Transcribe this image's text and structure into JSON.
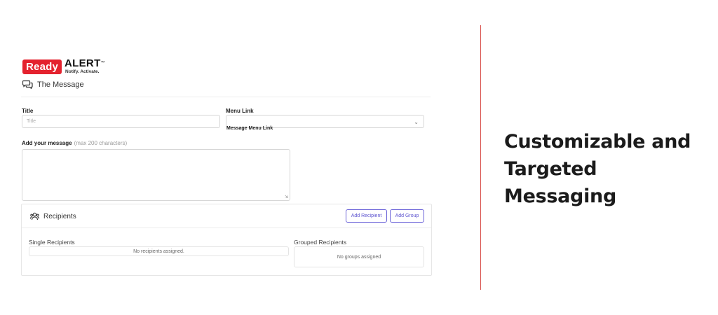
{
  "brand": {
    "badge": "Ready",
    "name": "ALERT",
    "trademark": "™",
    "tagline": "Notify. Activate."
  },
  "section": {
    "title": "The Message",
    "icon": "chat-bubbles-icon"
  },
  "form": {
    "title_label": "Title",
    "title_placeholder": "Title",
    "menu_link_label": "Menu Link",
    "menu_link_sublabel": "Message Menu Link",
    "message_label": "Add your message",
    "message_hint": "(max 200 characters)"
  },
  "recipients": {
    "title": "Recipients",
    "icon": "users-icon",
    "add_recipient": "Add Recipient",
    "add_group": "Add Group",
    "single_label": "Single Recipients",
    "single_empty": "No recipients assigned.",
    "grouped_label": "Grouped Recipients",
    "grouped_empty": "No groups assigned"
  },
  "headline": {
    "line1": "Customizable and",
    "line2": "Targeted Messaging"
  },
  "colors": {
    "brand_red": "#e4222e",
    "accent": "#6b63d8",
    "divider": "#d9534f"
  }
}
